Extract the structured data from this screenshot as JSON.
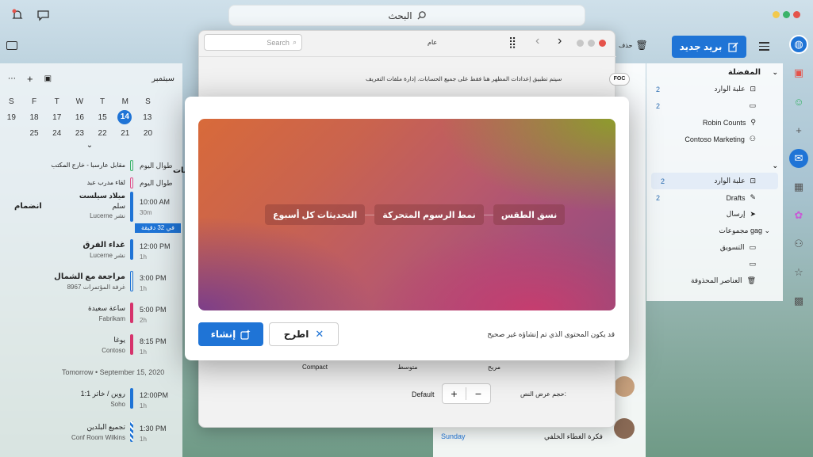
{
  "topbar": {
    "search_label": "البحث"
  },
  "toolbar": {
    "new_mail": "بريد جديد",
    "delete_label": "حذف"
  },
  "sidebar": {
    "favorites_title": "المفضلة",
    "favorites": [
      {
        "label": "علبة الوارد",
        "count": "2",
        "icon": "inbox-icon"
      },
      {
        "label": "",
        "count": "2",
        "icon": "folder-icon"
      },
      {
        "label": "Robin Counts",
        "count": "",
        "icon": "person-icon"
      },
      {
        "label": "Contoso Marketing",
        "count": "",
        "icon": "group-icon"
      }
    ],
    "account_items": [
      {
        "label": "علبة الوارد",
        "count": "2",
        "icon": "inbox-icon"
      },
      {
        "label": "Drafts",
        "count": "2",
        "icon": "draft-icon"
      },
      {
        "label": "إرسال",
        "count": "",
        "icon": "send-icon"
      }
    ],
    "group_label": "مجموعات gag",
    "group_items": [
      {
        "label": "التسويق",
        "icon": "folder-icon"
      },
      {
        "label": "",
        "icon": "folder-icon"
      },
      {
        "label": "العناصر المحذوفة",
        "icon": "trash-icon"
      }
    ]
  },
  "calendar": {
    "month": "سبتمبر",
    "weekdays": [
      "S",
      "M",
      "T",
      "W",
      "T",
      "F",
      "S"
    ],
    "weeks": [
      [
        "13",
        "14",
        "15",
        "16",
        "17",
        "18",
        "19"
      ],
      [
        "20",
        "21",
        "22",
        "23",
        "24",
        "25",
        ""
      ]
    ],
    "today": "14",
    "side_label_1": "كافة الحسابات",
    "side_label_2": "انضمام",
    "tomorrow_label": "Tomorrow • September 15, 2020",
    "events": [
      {
        "time": "طوال اليوم",
        "sub": "",
        "title": "مقابل عارسبا - خارج المكتب",
        "loc": "",
        "color": "#3bb36a"
      },
      {
        "time": "طوال اليوم",
        "sub": "",
        "title": "لقاء مدرب عبد",
        "loc": "",
        "color": "#e04f8a"
      },
      {
        "time": "10:00 AM",
        "sub": "30m",
        "title": "ميلاد سيلست",
        "title2": "سلم",
        "loc": "Lucerne نشر",
        "color": "#1f74d6",
        "badge": "في 32 دقيقة"
      },
      {
        "time": "12:00 PM",
        "sub": "1h",
        "title": "غداء الفرق",
        "loc": "Lucerne نشر",
        "color": "#1f74d6"
      },
      {
        "time": "3:00 PM",
        "sub": "1h",
        "title": "مراجعة مع الشمال",
        "loc": "غرفة المؤتمرات 8967",
        "color": "#1f74d6"
      },
      {
        "time": "5:00 PM",
        "sub": "2h",
        "title": "ساعة سعيدة",
        "loc": "Fabrikam",
        "color": "#d6336c"
      },
      {
        "time": "8:15 PM",
        "sub": "1h",
        "title": "يوغا",
        "loc": "Contoso",
        "color": "#d6336c"
      },
      {
        "time": "12:00PM",
        "sub": "1h",
        "title": "1:1 روين / خاتر",
        "loc": "Soho",
        "color": "#1f74d6"
      },
      {
        "time": "1:30 PM",
        "sub": "1h",
        "title": "تجميع البلدين",
        "loc": "Conf Room Wilkins",
        "color": "#1f74d6"
      }
    ]
  },
  "settings_window": {
    "search_placeholder": "Search",
    "title_fragment": "عام",
    "description": "سيتم تطبيق إعدادات المظهر هنا فقط على جميع الحسابات. إدارة ملفات التعريف",
    "density_labels": [
      "مريح",
      "متوسط",
      "Compact"
    ],
    "text_size_label": "حجم عرض النص:",
    "text_size_value": "Default",
    "focused_tab": "FOC"
  },
  "mail_list": {
    "snippet_sunday": "Sunday",
    "snippet_wallpaper": "فكرة الغطاء الخلفي"
  },
  "dialog": {
    "pills": [
      "نسق الطقس",
      "نمط الرسوم المتحركة",
      "التحديثات كل أسبوع"
    ],
    "create_label": "إنشاء",
    "discard_label": "اطرح",
    "disclaimer": "قد يكون المحتوى الذي تم إنشاؤه غير صحيح"
  }
}
